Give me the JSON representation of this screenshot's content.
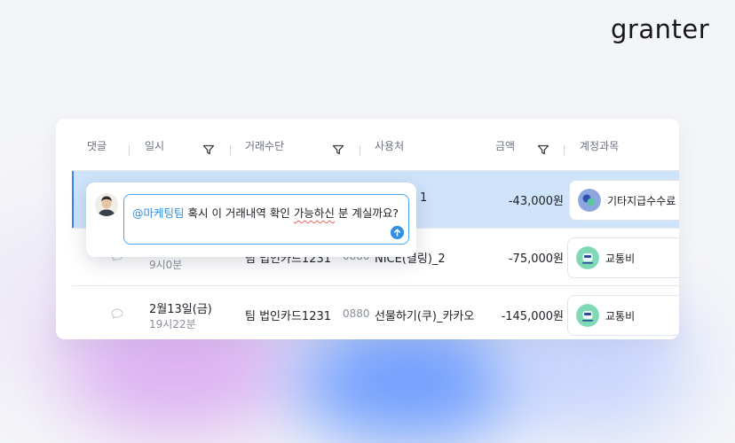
{
  "brand": {
    "logo": "granter"
  },
  "table": {
    "headers": {
      "comment": "댓글",
      "datetime": "일시",
      "method": "거래수단",
      "merchant": "사용처",
      "amount": "금액",
      "account": "계정과목"
    },
    "rows": [
      {
        "merchant_partial": "1",
        "amount": "-43,000원",
        "account": "기타지급수수료",
        "selected": true
      },
      {
        "time": "9시0분",
        "card_partial": "팀 법인카드1231",
        "card_suffix_partial": "0880",
        "merchant": "NICE(결링)_2",
        "amount": "-75,000원",
        "account": "교통비"
      },
      {
        "date": "2월13일(금)",
        "time": "19시22분",
        "card": "팀 법인카드1231",
        "card_suffix": "0880",
        "merchant": "선물하기(쿠)_카카오",
        "amount": "-145,000원",
        "account": "교통비"
      }
    ]
  },
  "comment_popup": {
    "mention": "@마케팅팀",
    "text_before": " 혹시 이 거래내역 확인 ",
    "text_underlined": "가능하신",
    "text_after": " 분 계실까요?"
  },
  "colors": {
    "accent": "#2f8fe0",
    "selected_row": "#cfe3fb",
    "account_icon_teal": "#7ed9b4",
    "account_icon_blue": "#8ea6e0"
  }
}
